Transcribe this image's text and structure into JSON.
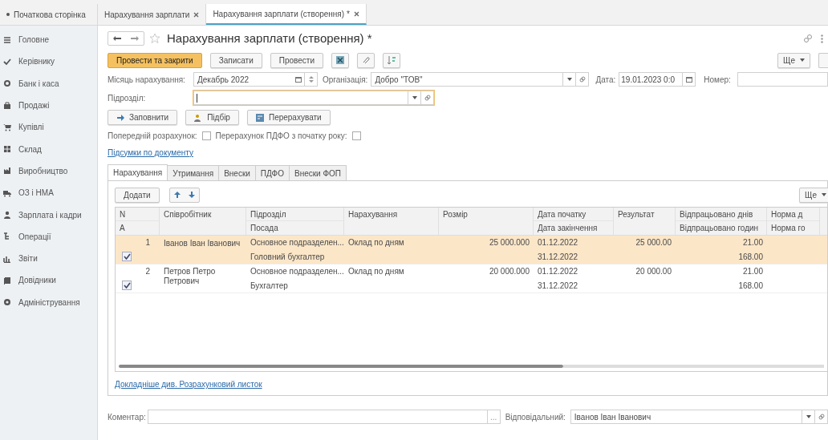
{
  "top_tabs": [
    {
      "label": "Початкова сторінка",
      "closable": false,
      "selected": false
    },
    {
      "label": "Нарахування зарплати",
      "closable": true,
      "selected": false
    },
    {
      "label": "Нарахування зарплати (створення) *",
      "closable": true,
      "selected": true
    }
  ],
  "sidebar": {
    "items": [
      {
        "label": "Головне"
      },
      {
        "label": "Керівнику"
      },
      {
        "label": "Банк і каса"
      },
      {
        "label": "Продажі"
      },
      {
        "label": "Купівлі"
      },
      {
        "label": "Склад"
      },
      {
        "label": "Виробництво"
      },
      {
        "label": "ОЗ і НМА"
      },
      {
        "label": "Зарплата і кадри"
      },
      {
        "label": "Операції"
      },
      {
        "label": "Звіти"
      },
      {
        "label": "Довідники"
      },
      {
        "label": "Адміністрування"
      }
    ]
  },
  "form": {
    "title": "Нарахування зарплати (створення) *",
    "toolbar": {
      "primary": "Провести та закрити",
      "buttons": [
        "Записати",
        "Провести"
      ],
      "more": "Ще"
    },
    "month": {
      "label": "Місяць нарахування:",
      "value": "Декабрь 2022"
    },
    "organization": {
      "label": "Організація:",
      "value": "Добро \"ТОВ\""
    },
    "date": {
      "label": "Дата:",
      "value": "19.01.2023  0:0"
    },
    "number": {
      "label": "Номер:"
    },
    "department": {
      "label": "Підрозділ:",
      "focused": true
    },
    "actions": [
      "Заповнити",
      "Підбір",
      "Перерахувати"
    ],
    "checkboxes": [
      {
        "label": "Попередній розрахунок:",
        "checked": false
      },
      {
        "label": "Перерахунок ПДФО з початку року:",
        "checked": false
      }
    ],
    "totals_link": "Підсумки по документу",
    "tabs": [
      {
        "label": "Нарахування",
        "selected": true
      },
      {
        "label": "Утримання",
        "selected": false
      },
      {
        "label": "Внески",
        "selected": false
      },
      {
        "label": "ПДФО",
        "selected": false
      },
      {
        "label": "Внески ФОП",
        "selected": false
      }
    ],
    "add_button": "Додати",
    "table_more": "Ще",
    "table": {
      "columns": [
        {
          "top": "N",
          "bottom": "A"
        },
        {
          "top": "Співробітник"
        },
        {
          "top": "Підрозділ",
          "bottom": "Посада"
        },
        {
          "top": "Нарахування"
        },
        {
          "top": "Розмір"
        },
        {
          "top": "Дата початку",
          "bottom": "Дата закінчення"
        },
        {
          "top": "Результат"
        },
        {
          "top": "Відпрацьовано днів",
          "bottom": "Відпрацьовано годин"
        },
        {
          "top": "Норма д",
          "bottom": "Норма го"
        }
      ],
      "rows": [
        {
          "selected": true,
          "checked": true,
          "number": "1",
          "employee": "Іванов Іван Іванович",
          "department": "Основное подразделен...",
          "position": "Головний бухгалтер",
          "accrual": "Оклад по дням",
          "amount": "25 000.000",
          "start_date": "01.12.2022",
          "end_date": "31.12.2022",
          "result": "25 000.00",
          "days": "21.00",
          "hours": "168.00"
        },
        {
          "selected": false,
          "checked": true,
          "number": "2",
          "employee": "Петров Петро Петрович",
          "department": "Основное подразделен...",
          "position": "Бухгалтер",
          "accrual": "Оклад по дням",
          "amount": "20 000.000",
          "start_date": "01.12.2022",
          "end_date": "31.12.2022",
          "result": "20 000.00",
          "days": "21.00",
          "hours": "168.00"
        }
      ]
    },
    "details_link": "Докладніше див. Розрахунковий листок",
    "comment": {
      "label": "Коментар:",
      "button": "..."
    },
    "responsible": {
      "label": "Відповідальний:",
      "value": "Іванов Іван Іванович"
    }
  }
}
